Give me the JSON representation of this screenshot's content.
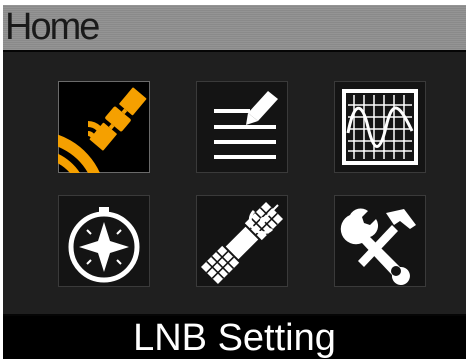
{
  "header": {
    "title": "Home"
  },
  "menu": {
    "items": [
      {
        "icon": "satellite-dish-icon",
        "selected": true
      },
      {
        "icon": "edit-list-icon",
        "selected": false
      },
      {
        "icon": "oscilloscope-icon",
        "selected": false
      },
      {
        "icon": "compass-icon",
        "selected": false
      },
      {
        "icon": "satellite-icon",
        "selected": false
      },
      {
        "icon": "tools-icon",
        "selected": false
      }
    ]
  },
  "status": {
    "label": "LNB Setting"
  },
  "colors": {
    "accent": "#f5a000",
    "icon": "#ffffff",
    "title_bar": "#8e8e8e",
    "background": "#1f1f1f"
  }
}
